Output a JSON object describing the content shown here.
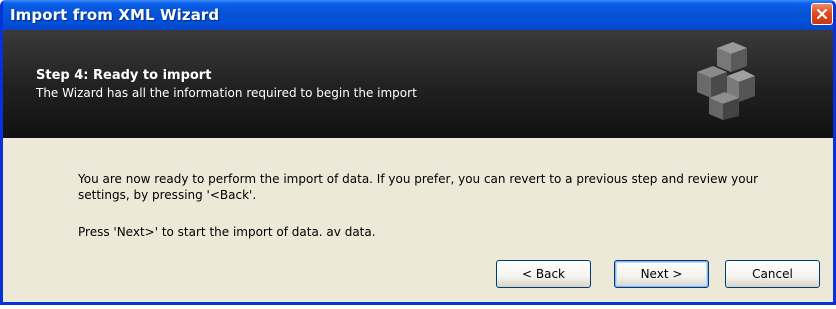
{
  "window": {
    "title": "Import from XML Wizard"
  },
  "header": {
    "step_title": "Step 4: Ready to import",
    "step_subtitle": "The Wizard has all the information required to begin the import",
    "icon": "cubes-icon"
  },
  "content": {
    "paragraph1": "You are now ready to perform the import of data. If you prefer, you can revert to a previous step and review your settings, by pressing '<Back'.",
    "paragraph2": "Press 'Next>' to start the import of data. av data."
  },
  "buttons": {
    "back_label": "< Back",
    "next_label": "Next >",
    "cancel_label": "Cancel"
  },
  "colors": {
    "titlebar": "#0754d8",
    "window_border": "#0831d9",
    "dialog_bg": "#ece9d8",
    "header_bg": "#202020",
    "close_button": "#e04a20"
  }
}
